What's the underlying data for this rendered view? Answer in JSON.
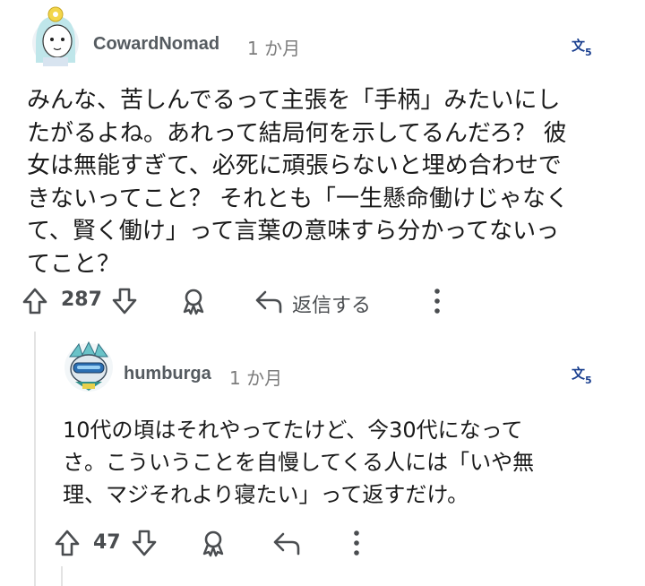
{
  "comments": [
    {
      "username": "CowardNomad",
      "time": "1 か月",
      "body_lines": [
        "みんな、苦しんでるって主張を「手柄」みたいにし",
        "たがるよね。あれって結局何を示してるんだろ？ 彼",
        "女は無能すぎて、必死に頑張らないと埋め合わせで",
        "きないってこと？ それとも「一生懸命働けじゃなく",
        "て、賢く働け」って言葉の意味すら分かってないっ",
        "てこと？"
      ],
      "votes": "287",
      "reply_label": "返信する"
    },
    {
      "username": "humburga",
      "time": "1 か月",
      "body_lines": [
        "10代の頃はそれやってたけど、今30代になって",
        "さ。こういうことを自慢してくる人には「いや無",
        "理、マジそれより寝たい」って返すだけ。"
      ],
      "votes": "47"
    }
  ],
  "colors": {
    "icon": "#4a4d50",
    "translate": "#1a3f8f",
    "thread_line": "#e3e3e3"
  },
  "icons": [
    "upvote-icon",
    "downvote-icon",
    "award-icon",
    "reply-icon",
    "more-options-icon",
    "translate-icon"
  ]
}
